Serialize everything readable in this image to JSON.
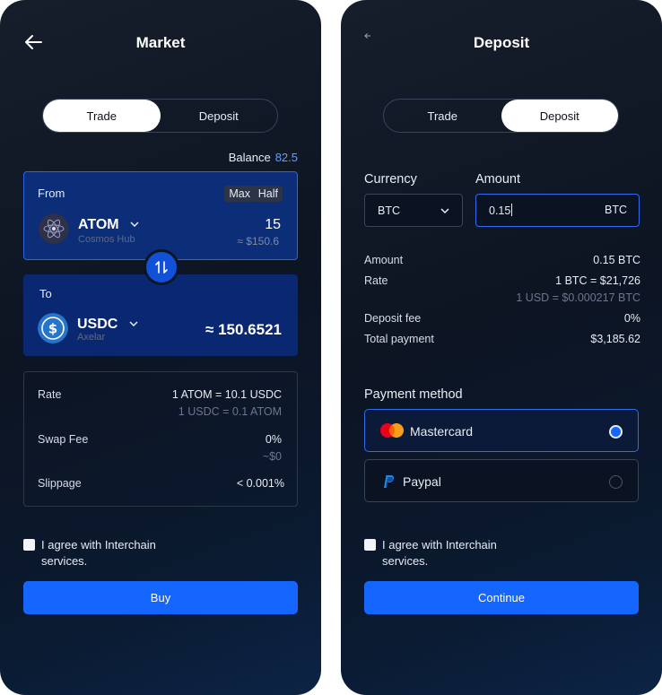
{
  "market": {
    "title": "Market",
    "tabs": [
      "Trade",
      "Deposit"
    ],
    "active_tab": "Trade",
    "balance_label": "Balance",
    "balance_value": "82.5",
    "from": {
      "label": "From",
      "max_label": "Max",
      "half_label": "Half",
      "token": "ATOM",
      "network": "Cosmos Hub",
      "amount": "15",
      "amount_usd": "≈ $150.6"
    },
    "to": {
      "label": "To",
      "token": "USDC",
      "network": "Axelar",
      "amount": "≈ 150.6521"
    },
    "info": {
      "rate_label": "Rate",
      "rate_value": "1 ATOM = 10.1 USDC",
      "rate_inverse": "1 USDC = 0.1 ATOM",
      "fee_label": "Swap Fee",
      "fee_value": "0%",
      "fee_usd": "~$0",
      "slippage_label": "Slippage",
      "slippage_value": "< 0.001%"
    },
    "agree_text": "I agree with Interchain services.",
    "buy_label": "Buy"
  },
  "deposit": {
    "title": "Deposit",
    "tabs": [
      "Trade",
      "Deposit"
    ],
    "active_tab": "Deposit",
    "currency_label": "Currency",
    "currency_value": "BTC",
    "amount_label": "Amount",
    "amount_value": "0.15",
    "amount_unit": "BTC",
    "summary": {
      "amount_label": "Amount",
      "amount_value": "0.15 BTC",
      "rate_label": "Rate",
      "rate_value": "1 BTC = $21,726",
      "rate_inverse": "1 USD = $0.000217 BTC",
      "fee_label": "Deposit fee",
      "fee_value": "0%",
      "total_label": "Total payment",
      "total_value": "$3,185.62"
    },
    "payment_title": "Payment method",
    "methods": [
      {
        "name": "Mastercard",
        "selected": true
      },
      {
        "name": "Paypal",
        "selected": false
      }
    ],
    "agree_text": "I agree with Interchain services.",
    "continue_label": "Continue"
  },
  "colors": {
    "accent": "#1466ff",
    "from_card": "#0c2d77",
    "to_card": "#0a2872",
    "balance_value": "#6a9cff"
  }
}
